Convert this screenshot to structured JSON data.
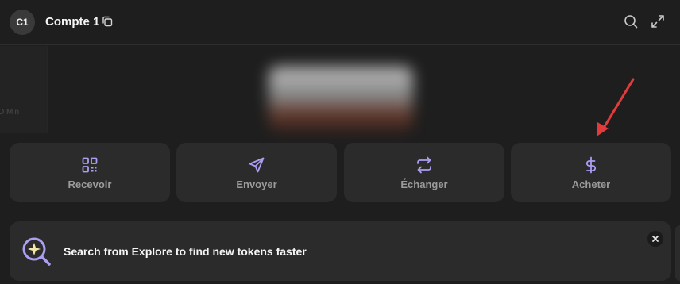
{
  "header": {
    "avatar_initials": "C1",
    "account_name": "Compte 1",
    "icons": [
      "copy-icon",
      "search-icon",
      "expand-icon"
    ]
  },
  "actions": [
    {
      "label": "Recevoir",
      "icon": "qr-code-icon"
    },
    {
      "label": "Envoyer",
      "icon": "send-icon"
    },
    {
      "label": "Échanger",
      "icon": "swap-icon"
    },
    {
      "label": "Acheter",
      "icon": "dollar-icon"
    }
  ],
  "side_text": "D Min",
  "banner": {
    "text": "Search from Explore to find new tokens faster",
    "icon": "explore-search-icon",
    "close_icon": "close-icon"
  },
  "colors": {
    "background": "#1e1e1e",
    "card": "#2b2b2b",
    "accent": "#ab9ff2",
    "annotation_arrow": "#e33b3b"
  }
}
